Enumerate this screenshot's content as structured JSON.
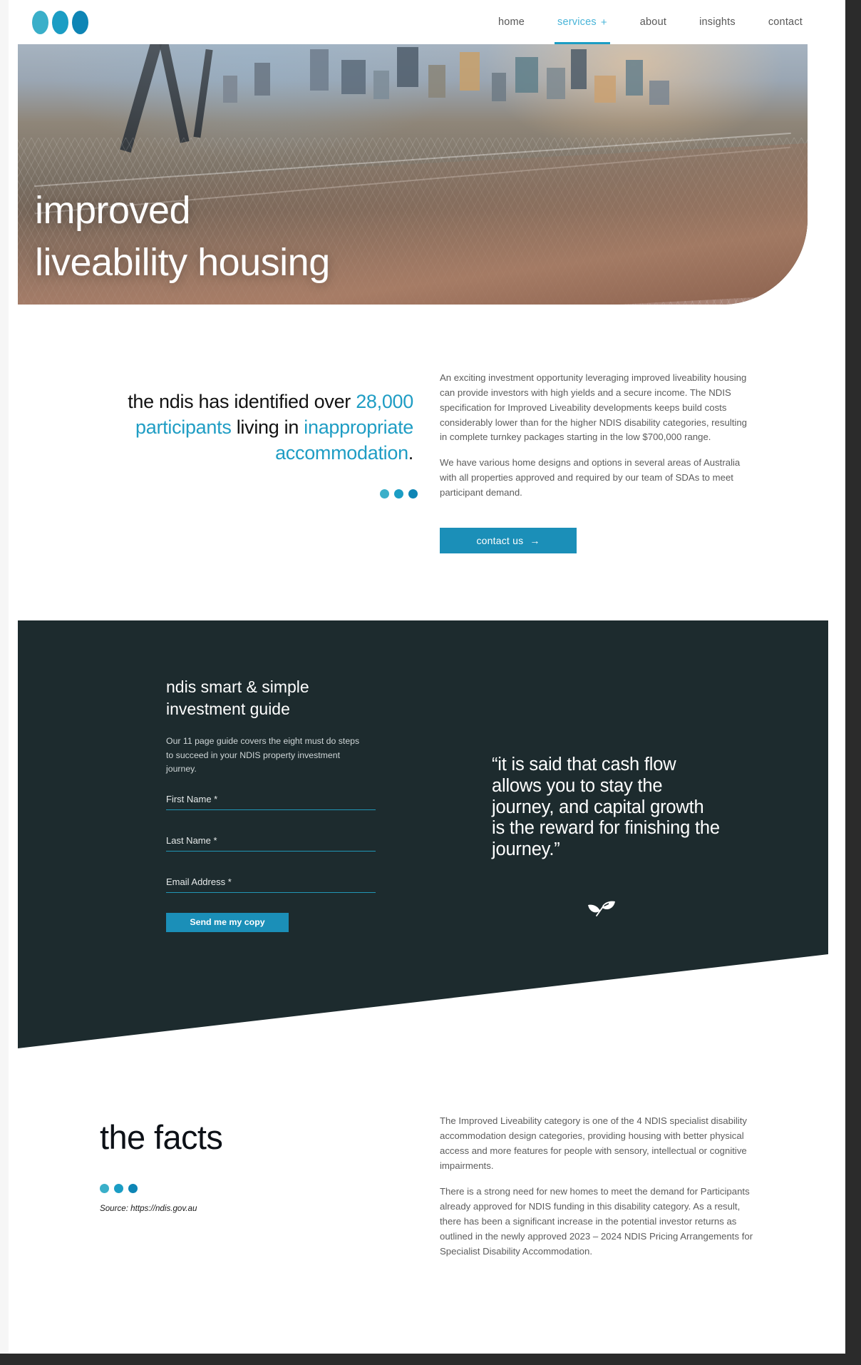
{
  "header": {
    "logo_name": "three-dot-logo",
    "nav": [
      {
        "label": "home",
        "active": false
      },
      {
        "label": "services",
        "suffix": "+",
        "active": true
      },
      {
        "label": "about",
        "active": false
      },
      {
        "label": "insights",
        "active": false
      },
      {
        "label": "contact",
        "active": false
      }
    ]
  },
  "hero": {
    "title_line1": "improved",
    "title_line2": "liveability housing",
    "image_alt": "city-skyline-bridge-at-dusk"
  },
  "intro": {
    "heading_part1": "the ndis has identified over ",
    "heading_highlight1": "28,000 participants",
    "heading_part2": " living in ",
    "heading_highlight2": "inappropriate accommodation",
    "heading_end": ".",
    "paragraphs": [
      "An exciting investment opportunity leveraging improved liveability housing can provide investors with high yields and a secure income. The NDIS specification for Improved Liveability developments keeps build costs considerably lower than for the higher NDIS disability categories, resulting in complete turnkey packages starting in the low $700,000 range.",
      "We have various home designs and options in several areas of Australia with all properties approved and required by our team of SDAs to meet participant demand."
    ],
    "cta_label": "contact us",
    "cta_arrow": "→"
  },
  "guide": {
    "title": "ndis smart & simple investment guide",
    "subtitle": "Our 11 page guide covers the eight must do steps to succeed in your NDIS property investment journey.",
    "fields": [
      {
        "name": "first-name",
        "placeholder": "First Name *",
        "value": ""
      },
      {
        "name": "last-name",
        "placeholder": "Last Name *",
        "value": ""
      },
      {
        "name": "email-address",
        "placeholder": "Email Address *",
        "value": ""
      }
    ],
    "submit_label": "Send me my copy",
    "quote": "“it is said that cash flow allows you to stay the journey, and capital growth is the reward for finishing the journey.”",
    "quote_icon": "leaf-sprout-icon"
  },
  "facts": {
    "title": "the facts",
    "source": "Source: https://ndis.gov.au",
    "paragraphs": [
      "The Improved Liveability category is one of the 4 NDIS specialist disability accommodation design categories, providing housing with better physical access and more features for people with sensory, intellectual or cognitive impairments.",
      "There is a strong need for new homes to meet the demand for Participants already approved for NDIS funding in this disability category. As a result, there has been a significant increase in the potential investor returns as outlined in the newly approved 2023 – 2024 NDIS Pricing Arrangements for Specialist Disability Accommodation."
    ]
  },
  "colors": {
    "accent_light": "#3aafc9",
    "accent": "#1b9dc4",
    "accent_dark": "#0e85b5",
    "button": "#1b8fb8",
    "dark_section": "#1d2b2e",
    "body_text": "#5c5c5c"
  }
}
